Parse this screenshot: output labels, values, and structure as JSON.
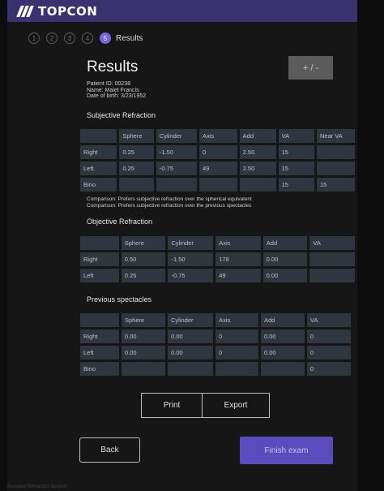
{
  "brand": {
    "name": "TOPCON"
  },
  "steps": {
    "items": [
      "1",
      "2",
      "3",
      "4",
      "5"
    ],
    "current_label": "Results"
  },
  "header": {
    "title": "Results",
    "plus_minus": "+ / -"
  },
  "patient": {
    "id": "Patient ID: 00238",
    "name": "Name: Maiet Francis",
    "dob": "Date of birth: 3/23/1952"
  },
  "subjective": {
    "title": "Subjective Refraction",
    "headers": [
      "",
      "Sphere",
      "Cylinder",
      "Axis",
      "Add",
      "VA",
      "Near VA"
    ],
    "rows": [
      [
        "Right",
        "0.25",
        "-1.50",
        "0",
        "2.50",
        "15",
        ""
      ],
      [
        "Left",
        "0.25",
        "-0.75",
        "49",
        "2.50",
        "15",
        ""
      ],
      [
        "Bino",
        "",
        "",
        "",
        "",
        "15",
        "15"
      ]
    ],
    "comparison": [
      "Comparison: Prefers subjective refraction over the spherical equivalent",
      "Comparison: Prefers subjective refraction over the previous spectacles"
    ]
  },
  "objective": {
    "title": "Objective Refraction",
    "headers": [
      "",
      "Sphere",
      "Cylinder",
      "Axis",
      "Add",
      "VA"
    ],
    "rows": [
      [
        "Right",
        "0.50",
        "-1.50",
        "178",
        "0.00",
        ""
      ],
      [
        "Left",
        "0.25",
        "-0.75",
        "49",
        "0.00",
        ""
      ]
    ]
  },
  "previous": {
    "title": "Previous spectacles",
    "headers": [
      "",
      "Sphere",
      "Cylinder",
      "Axis",
      "Add",
      "VA"
    ],
    "rows": [
      [
        "Right",
        "0.00",
        "0.00",
        "0",
        "0.00",
        "0"
      ],
      [
        "Left",
        "0.00",
        "0.00",
        "0",
        "0.00",
        "0"
      ],
      [
        "Bino",
        "",
        "",
        "",
        "",
        "0"
      ]
    ]
  },
  "actions": {
    "print": "Print",
    "export": "Export",
    "back": "Back",
    "finish": "Finish exam"
  },
  "footer": {
    "text": "Assisted Refraction System"
  }
}
